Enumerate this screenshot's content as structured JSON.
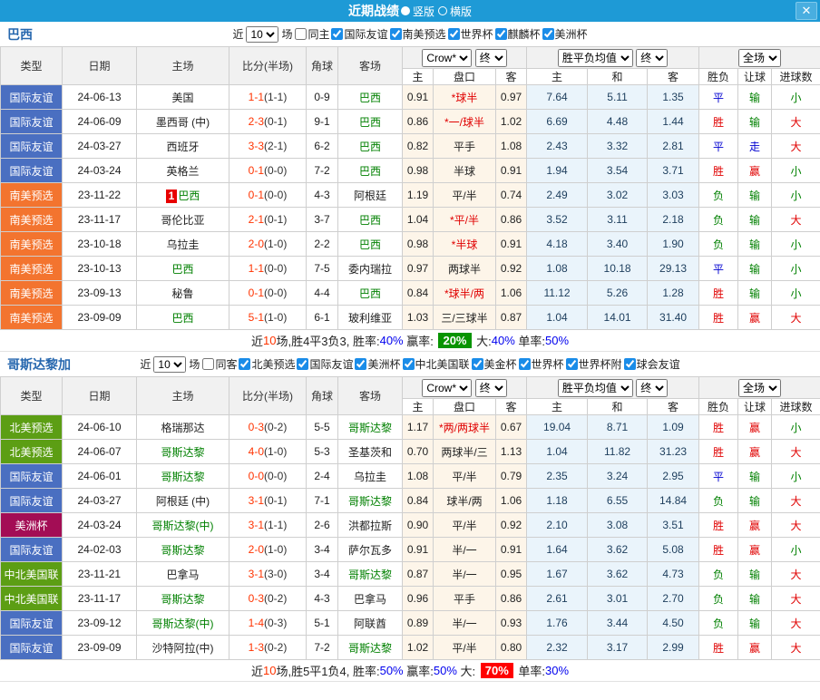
{
  "titlebar": {
    "title": "近期战绩",
    "radio_vertical": "竖版",
    "radio_horizontal": "横版",
    "close": "✕"
  },
  "colors": {
    "titlebar_bg": "#1e9ad6",
    "section_title": "#2667ae",
    "league": {
      "国际友谊": "#4a6fc1",
      "南美预选": "#f3742f",
      "北美预选": "#5c9e14",
      "中北美国联": "#5c9e14",
      "美洲杯": "#a30d55"
    },
    "score": "#ff3300",
    "half_score": "#333333",
    "self_team": "#008000",
    "win": "#e00000",
    "draw": "#0000d0",
    "lose": "#008000",
    "avg_text": "#1c3d5c",
    "percent": "#0000ee",
    "highlight_green": "#089400",
    "highlight_red": "#ff0000"
  },
  "table_header": {
    "main": [
      "类型",
      "日期",
      "主场",
      "比分(半场)",
      "角球",
      "客场"
    ],
    "sub": [
      "主",
      "盘口",
      "客",
      "主",
      "和",
      "客",
      "胜负",
      "让球",
      "进球数"
    ],
    "dropdown_odds": "Crow*",
    "dropdown_final1": "终",
    "dropdown_avg": "胜平负均值",
    "dropdown_final2": "终",
    "dropdown_scope": "全场"
  },
  "sections": [
    {
      "team": "巴西",
      "filter": {
        "near_label": "近",
        "count": "10",
        "games_label": "场",
        "checkboxes": [
          {
            "label": "同主",
            "checked": false
          },
          {
            "label": "国际友谊",
            "checked": true
          },
          {
            "label": "南美预选",
            "checked": true
          },
          {
            "label": "世界杯",
            "checked": true
          },
          {
            "label": "麒麟杯",
            "checked": true
          },
          {
            "label": "美洲杯",
            "checked": true
          }
        ]
      },
      "rows": [
        {
          "league": "国际友谊",
          "date": "24-06-13",
          "home": "美国",
          "home_self": false,
          "rank": "",
          "score": "1-1",
          "half": "(1-1)",
          "corners": "0-9",
          "away": "巴西",
          "away_self": true,
          "home_odds": "0.91",
          "handicap": "*球半",
          "away_odds": "0.97",
          "avg_win": "7.64",
          "avg_draw": "5.11",
          "avg_lose": "1.35",
          "result": "平",
          "handicap_result": "输",
          "goals": "小"
        },
        {
          "league": "国际友谊",
          "date": "24-06-09",
          "home": "墨西哥 (中)",
          "home_self": false,
          "rank": "",
          "score": "2-3",
          "half": "(0-1)",
          "corners": "9-1",
          "away": "巴西",
          "away_self": true,
          "home_odds": "0.86",
          "handicap": "*一/球半",
          "away_odds": "1.02",
          "avg_win": "6.69",
          "avg_draw": "4.48",
          "avg_lose": "1.44",
          "result": "胜",
          "handicap_result": "输",
          "goals": "大"
        },
        {
          "league": "国际友谊",
          "date": "24-03-27",
          "home": "西班牙",
          "home_self": false,
          "rank": "",
          "score": "3-3",
          "half": "(2-1)",
          "corners": "6-2",
          "away": "巴西",
          "away_self": true,
          "home_odds": "0.82",
          "handicap": "平手",
          "away_odds": "1.08",
          "avg_win": "2.43",
          "avg_draw": "3.32",
          "avg_lose": "2.81",
          "result": "平",
          "handicap_result": "走",
          "goals": "大"
        },
        {
          "league": "国际友谊",
          "date": "24-03-24",
          "home": "英格兰",
          "home_self": false,
          "rank": "",
          "score": "0-1",
          "half": "(0-0)",
          "corners": "7-2",
          "away": "巴西",
          "away_self": true,
          "home_odds": "0.98",
          "handicap": "半球",
          "away_odds": "0.91",
          "avg_win": "1.94",
          "avg_draw": "3.54",
          "avg_lose": "3.71",
          "result": "胜",
          "handicap_result": "赢",
          "goals": "小"
        },
        {
          "league": "南美预选",
          "date": "23-11-22",
          "home": "巴西",
          "home_self": true,
          "rank": "1",
          "score": "0-1",
          "half": "(0-0)",
          "corners": "4-3",
          "away": "阿根廷",
          "away_self": false,
          "home_odds": "1.19",
          "handicap": "平/半",
          "away_odds": "0.74",
          "avg_win": "2.49",
          "avg_draw": "3.02",
          "avg_lose": "3.03",
          "result": "负",
          "handicap_result": "输",
          "goals": "小"
        },
        {
          "league": "南美预选",
          "date": "23-11-17",
          "home": "哥伦比亚",
          "home_self": false,
          "rank": "",
          "score": "2-1",
          "half": "(0-1)",
          "corners": "3-7",
          "away": "巴西",
          "away_self": true,
          "home_odds": "1.04",
          "handicap": "*平/半",
          "away_odds": "0.86",
          "avg_win": "3.52",
          "avg_draw": "3.11",
          "avg_lose": "2.18",
          "result": "负",
          "handicap_result": "输",
          "goals": "大"
        },
        {
          "league": "南美预选",
          "date": "23-10-18",
          "home": "乌拉圭",
          "home_self": false,
          "rank": "",
          "score": "2-0",
          "half": "(1-0)",
          "corners": "2-2",
          "away": "巴西",
          "away_self": true,
          "home_odds": "0.98",
          "handicap": "*半球",
          "away_odds": "0.91",
          "avg_win": "4.18",
          "avg_draw": "3.40",
          "avg_lose": "1.90",
          "result": "负",
          "handicap_result": "输",
          "goals": "小"
        },
        {
          "league": "南美预选",
          "date": "23-10-13",
          "home": "巴西",
          "home_self": true,
          "rank": "",
          "score": "1-1",
          "half": "(0-0)",
          "corners": "7-5",
          "away": "委内瑞拉",
          "away_self": false,
          "home_odds": "0.97",
          "handicap": "两球半",
          "away_odds": "0.92",
          "avg_win": "1.08",
          "avg_draw": "10.18",
          "avg_lose": "29.13",
          "result": "平",
          "handicap_result": "输",
          "goals": "小"
        },
        {
          "league": "南美预选",
          "date": "23-09-13",
          "home": "秘鲁",
          "home_self": false,
          "rank": "",
          "score": "0-1",
          "half": "(0-0)",
          "corners": "4-4",
          "away": "巴西",
          "away_self": true,
          "home_odds": "0.84",
          "handicap": "*球半/两",
          "away_odds": "1.06",
          "avg_win": "11.12",
          "avg_draw": "5.26",
          "avg_lose": "1.28",
          "result": "胜",
          "handicap_result": "输",
          "goals": "小"
        },
        {
          "league": "南美预选",
          "date": "23-09-09",
          "home": "巴西",
          "home_self": true,
          "rank": "",
          "score": "5-1",
          "half": "(1-0)",
          "corners": "6-1",
          "away": "玻利维亚",
          "away_self": false,
          "home_odds": "1.03",
          "handicap": "三/三球半",
          "away_odds": "0.87",
          "avg_win": "1.04",
          "avg_draw": "14.01",
          "avg_lose": "31.40",
          "result": "胜",
          "handicap_result": "赢",
          "goals": "大"
        }
      ],
      "summary": [
        {
          "t": "近",
          "c": "k"
        },
        {
          "t": "10",
          "c": "r"
        },
        {
          "t": "场,胜4平3负3, 胜率:",
          "c": "k"
        },
        {
          "t": "40%",
          "c": "b"
        },
        {
          "t": " 赢率: ",
          "c": "k"
        },
        {
          "t": "20%",
          "c": "hg"
        },
        {
          "t": " 大:",
          "c": "k"
        },
        {
          "t": "40%",
          "c": "b"
        },
        {
          "t": " 单率:",
          "c": "k"
        },
        {
          "t": "50%",
          "c": "b"
        }
      ]
    },
    {
      "team": "哥斯达黎加",
      "filter": {
        "near_label": "近",
        "count": "10",
        "games_label": "场",
        "checkboxes": [
          {
            "label": "同客",
            "checked": false
          },
          {
            "label": "北美预选",
            "checked": true
          },
          {
            "label": "国际友谊",
            "checked": true
          },
          {
            "label": "美洲杯",
            "checked": true
          },
          {
            "label": "中北美国联",
            "checked": true
          },
          {
            "label": "美金杯",
            "checked": true
          },
          {
            "label": "世界杯",
            "checked": true
          },
          {
            "label": "世界杯附",
            "checked": true
          },
          {
            "label": "球会友谊",
            "checked": true
          }
        ]
      },
      "rows": [
        {
          "league": "北美预选",
          "date": "24-06-10",
          "home": "格瑞那达",
          "home_self": false,
          "rank": "",
          "score": "0-3",
          "half": "(0-2)",
          "corners": "5-5",
          "away": "哥斯达黎",
          "away_self": true,
          "home_odds": "1.17",
          "handicap": "*两/两球半",
          "away_odds": "0.67",
          "avg_win": "19.04",
          "avg_draw": "8.71",
          "avg_lose": "1.09",
          "result": "胜",
          "handicap_result": "赢",
          "goals": "小"
        },
        {
          "league": "北美预选",
          "date": "24-06-07",
          "home": "哥斯达黎",
          "home_self": true,
          "rank": "",
          "score": "4-0",
          "half": "(1-0)",
          "corners": "5-3",
          "away": "圣基茨和",
          "away_self": false,
          "home_odds": "0.70",
          "handicap": "两球半/三",
          "away_odds": "1.13",
          "avg_win": "1.04",
          "avg_draw": "11.82",
          "avg_lose": "31.23",
          "result": "胜",
          "handicap_result": "赢",
          "goals": "大"
        },
        {
          "league": "国际友谊",
          "date": "24-06-01",
          "home": "哥斯达黎",
          "home_self": true,
          "rank": "",
          "score": "0-0",
          "half": "(0-0)",
          "corners": "2-4",
          "away": "乌拉圭",
          "away_self": false,
          "home_odds": "1.08",
          "handicap": "平/半",
          "away_odds": "0.79",
          "avg_win": "2.35",
          "avg_draw": "3.24",
          "avg_lose": "2.95",
          "result": "平",
          "handicap_result": "输",
          "goals": "小"
        },
        {
          "league": "国际友谊",
          "date": "24-03-27",
          "home": "阿根廷 (中)",
          "home_self": false,
          "rank": "",
          "score": "3-1",
          "half": "(0-1)",
          "corners": "7-1",
          "away": "哥斯达黎",
          "away_self": true,
          "home_odds": "0.84",
          "handicap": "球半/两",
          "away_odds": "1.06",
          "avg_win": "1.18",
          "avg_draw": "6.55",
          "avg_lose": "14.84",
          "result": "负",
          "handicap_result": "输",
          "goals": "大"
        },
        {
          "league": "美洲杯",
          "date": "24-03-24",
          "home": "哥斯达黎(中)",
          "home_self": true,
          "rank": "",
          "score": "3-1",
          "half": "(1-1)",
          "corners": "2-6",
          "away": "洪都拉斯",
          "away_self": false,
          "home_odds": "0.90",
          "handicap": "平/半",
          "away_odds": "0.92",
          "avg_win": "2.10",
          "avg_draw": "3.08",
          "avg_lose": "3.51",
          "result": "胜",
          "handicap_result": "赢",
          "goals": "大"
        },
        {
          "league": "国际友谊",
          "date": "24-02-03",
          "home": "哥斯达黎",
          "home_self": true,
          "rank": "",
          "score": "2-0",
          "half": "(1-0)",
          "corners": "3-4",
          "away": "萨尔瓦多",
          "away_self": false,
          "home_odds": "0.91",
          "handicap": "半/一",
          "away_odds": "0.91",
          "avg_win": "1.64",
          "avg_draw": "3.62",
          "avg_lose": "5.08",
          "result": "胜",
          "handicap_result": "赢",
          "goals": "小"
        },
        {
          "league": "中北美国联",
          "date": "23-11-21",
          "home": "巴拿马",
          "home_self": false,
          "rank": "",
          "score": "3-1",
          "half": "(3-0)",
          "corners": "3-4",
          "away": "哥斯达黎",
          "away_self": true,
          "home_odds": "0.87",
          "handicap": "半/一",
          "away_odds": "0.95",
          "avg_win": "1.67",
          "avg_draw": "3.62",
          "avg_lose": "4.73",
          "result": "负",
          "handicap_result": "输",
          "goals": "大"
        },
        {
          "league": "中北美国联",
          "date": "23-11-17",
          "home": "哥斯达黎",
          "home_self": true,
          "rank": "",
          "score": "0-3",
          "half": "(0-2)",
          "corners": "4-3",
          "away": "巴拿马",
          "away_self": false,
          "home_odds": "0.96",
          "handicap": "平手",
          "away_odds": "0.86",
          "avg_win": "2.61",
          "avg_draw": "3.01",
          "avg_lose": "2.70",
          "result": "负",
          "handicap_result": "输",
          "goals": "大"
        },
        {
          "league": "国际友谊",
          "date": "23-09-12",
          "home": "哥斯达黎(中)",
          "home_self": true,
          "rank": "",
          "score": "1-4",
          "half": "(0-3)",
          "corners": "5-1",
          "away": "阿联酋",
          "away_self": false,
          "home_odds": "0.89",
          "handicap": "半/一",
          "away_odds": "0.93",
          "avg_win": "1.76",
          "avg_draw": "3.44",
          "avg_lose": "4.50",
          "result": "负",
          "handicap_result": "输",
          "goals": "大"
        },
        {
          "league": "国际友谊",
          "date": "23-09-09",
          "home": "沙特阿拉(中)",
          "home_self": false,
          "rank": "",
          "score": "1-3",
          "half": "(0-2)",
          "corners": "7-2",
          "away": "哥斯达黎",
          "away_self": true,
          "home_odds": "1.02",
          "handicap": "平/半",
          "away_odds": "0.80",
          "avg_win": "2.32",
          "avg_draw": "3.17",
          "avg_lose": "2.99",
          "result": "胜",
          "handicap_result": "赢",
          "goals": "大"
        }
      ],
      "summary": [
        {
          "t": "近",
          "c": "k"
        },
        {
          "t": "10",
          "c": "r"
        },
        {
          "t": "场,胜5平1负4, 胜率:",
          "c": "k"
        },
        {
          "t": "50%",
          "c": "b"
        },
        {
          "t": " 赢率:",
          "c": "k"
        },
        {
          "t": "50%",
          "c": "b"
        },
        {
          "t": " 大: ",
          "c": "k"
        },
        {
          "t": "70%",
          "c": "hr"
        },
        {
          "t": " 单率:",
          "c": "k"
        },
        {
          "t": "30%",
          "c": "b"
        }
      ]
    }
  ]
}
